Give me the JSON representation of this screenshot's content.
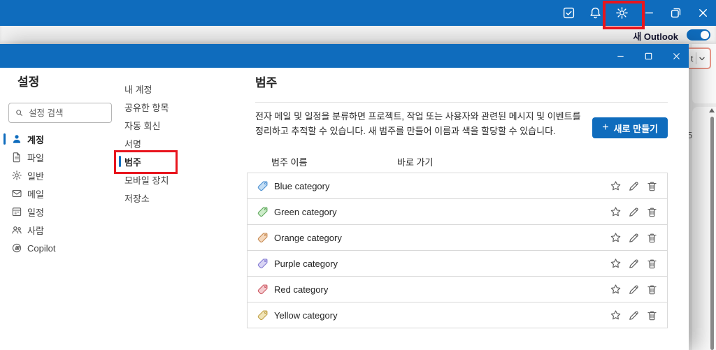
{
  "titlebar": {
    "icons": [
      {
        "name": "my-day-icon",
        "shape": "square-with-check"
      },
      {
        "name": "bell-icon",
        "shape": "bell"
      },
      {
        "name": "gear-icon",
        "shape": "gear",
        "annotated": true
      }
    ],
    "window_controls": [
      "minimize",
      "restore",
      "close"
    ]
  },
  "new_outlook": {
    "label": "새 Outlook",
    "enabled": true
  },
  "background_window": {
    "partial_count": "5",
    "dropdown_partial_text": "t",
    "dropdown_chevron_icon": "chevron-down"
  },
  "settings_dialog": {
    "window_controls": [
      "minimize",
      "maximize",
      "close"
    ],
    "sidebar": {
      "title": "설정",
      "search_placeholder": "설정 검색",
      "items": [
        {
          "label": "계정",
          "icon": "person-icon",
          "selected": true
        },
        {
          "label": "파일",
          "icon": "file-icon",
          "selected": false
        },
        {
          "label": "일반",
          "icon": "gear-icon",
          "selected": false
        },
        {
          "label": "메일",
          "icon": "mail-icon",
          "selected": false
        },
        {
          "label": "일정",
          "icon": "calendar-icon",
          "selected": false
        },
        {
          "label": "사람",
          "icon": "people-icon",
          "selected": false
        },
        {
          "label": "Copilot",
          "icon": "copilot-icon",
          "selected": false
        }
      ]
    },
    "subnav": {
      "items": [
        {
          "label": "내 계정",
          "selected": false
        },
        {
          "label": "공유한 항목",
          "selected": false
        },
        {
          "label": "자동 회신",
          "selected": false
        },
        {
          "label": "서명",
          "selected": false
        },
        {
          "label": "범주",
          "selected": true,
          "highlighted": true
        },
        {
          "label": "모바일 장치",
          "selected": false
        },
        {
          "label": "저장소",
          "selected": false
        }
      ]
    },
    "content": {
      "title": "범주",
      "description_line1": "전자 메일 및 일정을 분류하면 프로젝트, 작업 또는 사용자와 관련된 메시지 및 이벤트를",
      "description_line2": "정리하고 추적할 수 있습니다. 새 범주를 만들어 이름과 색을 할당할 수 있습니다.",
      "new_button_plus": "+",
      "new_button_label": "새로 만들기",
      "columns": {
        "name": "범주 이름",
        "shortcut": "바로 가기"
      },
      "row_action_icons": [
        "star-icon",
        "pencil-icon",
        "trash-icon"
      ],
      "rows": [
        {
          "name": "Blue category",
          "tag_fill": "#c4def5",
          "tag_stroke": "#4a8fd0"
        },
        {
          "name": "Green category",
          "tag_fill": "#cdecca",
          "tag_stroke": "#5fa85c"
        },
        {
          "name": "Orange category",
          "tag_fill": "#f4d8bd",
          "tag_stroke": "#c78a52"
        },
        {
          "name": "Purple category",
          "tag_fill": "#d8d4f4",
          "tag_stroke": "#837ad3"
        },
        {
          "name": "Red category",
          "tag_fill": "#f4ccd0",
          "tag_stroke": "#cc5660"
        },
        {
          "name": "Yellow category",
          "tag_fill": "#f1e4b7",
          "tag_stroke": "#bfa045"
        }
      ]
    }
  },
  "colors": {
    "accent": "#0f6cbd",
    "annotation_red": "#e8151d",
    "titlebar_blue": "#0f6cbd"
  }
}
